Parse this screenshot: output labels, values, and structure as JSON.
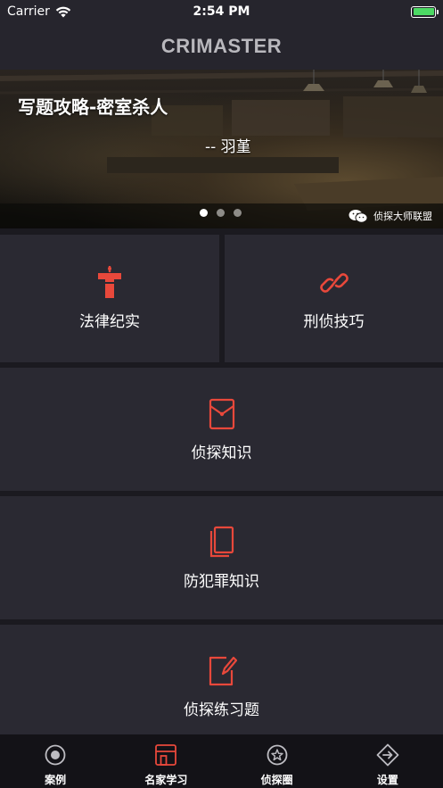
{
  "status_bar": {
    "carrier": "Carrier",
    "time": "2:54 PM",
    "battery_level": 1.0
  },
  "nav": {
    "title": "CRIMASTER"
  },
  "banner": {
    "title": "写题攻略-密室杀人",
    "author": "-- 羽堇",
    "watermark": "侦探大师联盟",
    "page_count": 3,
    "active_page": 0
  },
  "menu": {
    "items": [
      {
        "label": "法律纪实",
        "icon": "podium-icon"
      },
      {
        "label": "刑侦技巧",
        "icon": "link-icon"
      },
      {
        "label": "侦探知识",
        "icon": "envelope-icon"
      },
      {
        "label": "防犯罪知识",
        "icon": "documents-icon"
      },
      {
        "label": "侦探练习题",
        "icon": "edit-icon"
      }
    ]
  },
  "tab_bar": {
    "tabs": [
      {
        "label": "案例",
        "icon": "record-icon",
        "active": false
      },
      {
        "label": "名家学习",
        "icon": "layout-icon",
        "active": true
      },
      {
        "label": "侦探圈",
        "icon": "star-circle-icon",
        "active": false
      },
      {
        "label": "设置",
        "icon": "diamond-arrow-icon",
        "active": false
      }
    ]
  },
  "colors": {
    "accent": "#e8483b",
    "tile_bg": "#2a2932",
    "page_bg": "#1b1a20",
    "tab_inactive": "#bdbcc2"
  }
}
